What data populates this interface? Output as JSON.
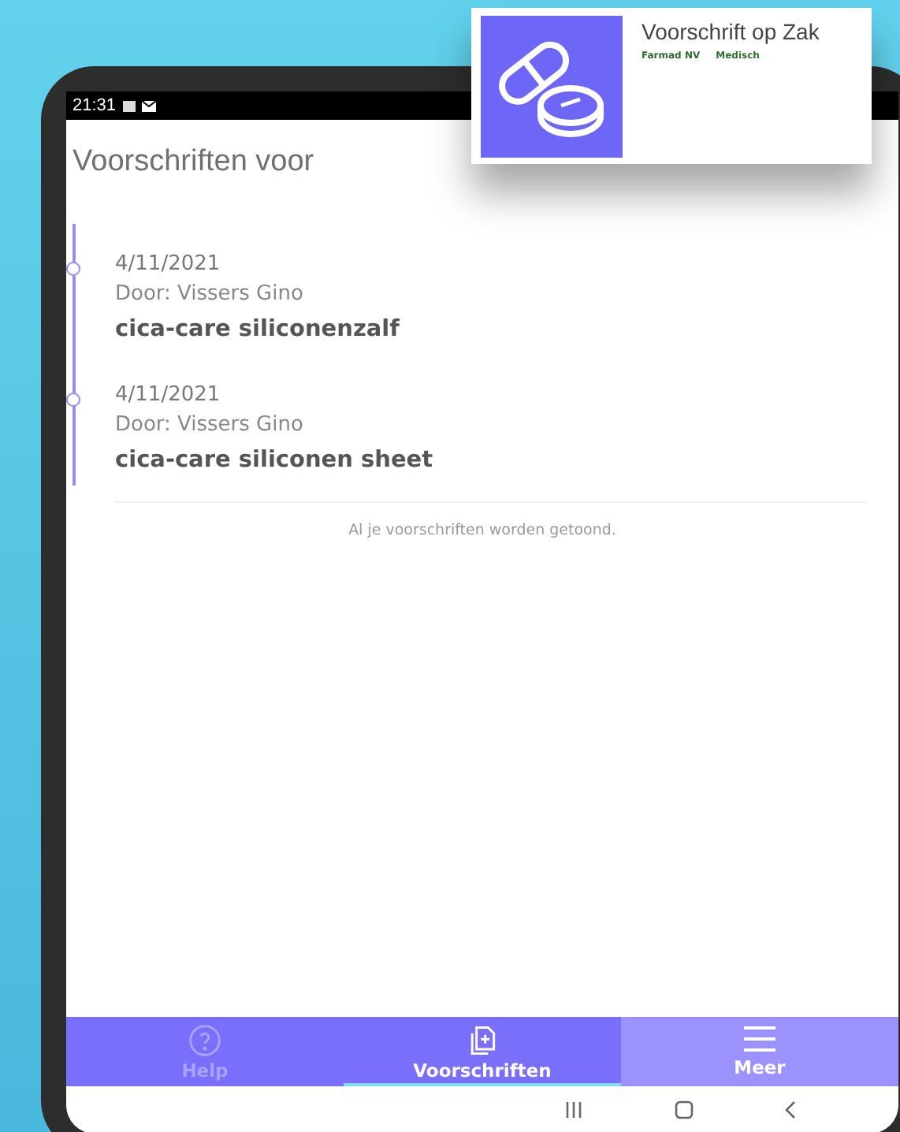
{
  "status_bar": {
    "time": "21:31"
  },
  "header": {
    "title": "Voorschriften voor"
  },
  "prescriptions": [
    {
      "date": "4/11/2021",
      "doctor": "Door: Vissers Gino",
      "name": "cica-care siliconenzalf"
    },
    {
      "date": "4/11/2021",
      "doctor": "Door: Vissers Gino",
      "name": "cica-care siliconen sheet"
    }
  ],
  "end_message": "Al je voorschriften worden getoond.",
  "tabs": [
    {
      "label": "Help",
      "kind": "help",
      "selected": false,
      "highlighted": false
    },
    {
      "label": "Voorschriften",
      "kind": "prescriptions",
      "selected": true,
      "highlighted": false
    },
    {
      "label": "Meer",
      "kind": "more",
      "selected": false,
      "highlighted": true
    }
  ],
  "app_card": {
    "title": "Voorschrift op Zak",
    "developer": "Farmad NV",
    "category": "Medisch"
  }
}
